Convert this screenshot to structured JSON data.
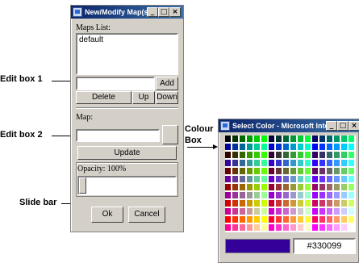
{
  "dialog": {
    "title": "New/Modify Map(s)...",
    "maps_list_label": "Maps List:",
    "maps_list_items": [
      "default"
    ],
    "edit_box_1_value": "",
    "add_label": "Add",
    "delete_label": "Delete",
    "up_label": "Up",
    "down_label": "Down",
    "map_label": "Map:",
    "edit_box_2_value": "",
    "update_label": "Update",
    "opacity_label": "Opacity: 100%",
    "opacity_value": 1.0,
    "ok_label": "Ok",
    "cancel_label": "Cancel",
    "window_controls": [
      "_",
      "□",
      "×"
    ]
  },
  "annotations": {
    "edit_box_1": "Edit box 1",
    "edit_box_2": "Edit box 2",
    "slide_bar": "Slide bar",
    "colour_box_line1": "Colour",
    "colour_box_line2": "Box"
  },
  "color_dialog": {
    "title": "Select Color - Microsoft Intern...",
    "selected_hex": "#330099",
    "selected_color": "#330099"
  }
}
